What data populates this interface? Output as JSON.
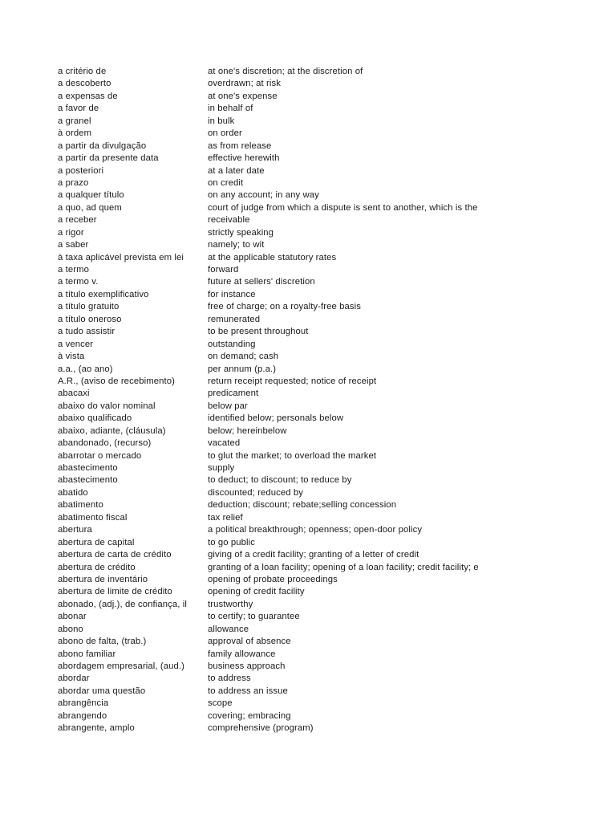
{
  "document": {
    "type": "glossary",
    "page_background": "#ffffff",
    "text_color": "#1a1a1a",
    "columns": {
      "term_header": "",
      "definition_header": ""
    }
  },
  "entries": [
    {
      "term": "a critério de",
      "definition": "at one's discretion; at the discretion of"
    },
    {
      "term": "a descoberto",
      "definition": "overdrawn; at risk"
    },
    {
      "term": "a expensas de",
      "definition": "at one's expense"
    },
    {
      "term": "a favor de",
      "definition": "in behalf of"
    },
    {
      "term": "a granel",
      "definition": "in bulk"
    },
    {
      "term": "à ordem",
      "definition": "on order"
    },
    {
      "term": "a partir da divulgação",
      "definition": "as from release"
    },
    {
      "term": "a partir da presente data",
      "definition": "effective herewith"
    },
    {
      "term": "a posteriori",
      "definition": "at a later date"
    },
    {
      "term": "a prazo",
      "definition": "on credit"
    },
    {
      "term": "a qualquer título",
      "definition": "on any account; in any way"
    },
    {
      "term": "a quo, ad quem",
      "definition": "court of judge from which a dispute is sent to another, which is the"
    },
    {
      "term": "a receber",
      "definition": "receivable"
    },
    {
      "term": "a rigor",
      "definition": "strictly speaking"
    },
    {
      "term": "a saber",
      "definition": "namely; to wit"
    },
    {
      "term": "à taxa aplicável prevista em lei",
      "definition": "at the applicable statutory rates"
    },
    {
      "term": "a termo",
      "definition": "forward"
    },
    {
      "term": "a termo v.",
      "definition": "future at sellers' discretion"
    },
    {
      "term": "a título exemplificativo",
      "definition": "for instance"
    },
    {
      "term": "a título gratuito",
      "definition": "free of charge; on a royalty-free basis"
    },
    {
      "term": "a título oneroso",
      "definition": "remunerated"
    },
    {
      "term": "a tudo assistir",
      "definition": "to be present throughout"
    },
    {
      "term": "a vencer",
      "definition": "outstanding"
    },
    {
      "term": "à vista",
      "definition": "on demand; cash"
    },
    {
      "term": "a.a., (ao ano)",
      "definition": "per annum (p.a.)"
    },
    {
      "term": "A.R., (aviso de recebimento)",
      "definition": "return receipt requested; notice of receipt"
    },
    {
      "term": "abacaxi",
      "definition": "predicament"
    },
    {
      "term": "abaixo do valor nominal",
      "definition": "below par"
    },
    {
      "term": "abaixo qualificado",
      "definition": "identified below; personals below"
    },
    {
      "term": "abaixo, adiante, (cláusula)",
      "definition": "below; hereinbelow"
    },
    {
      "term": "abandonado, (recurso)",
      "definition": "vacated"
    },
    {
      "term": "abarrotar o mercado",
      "definition": "to glut the market; to overload the market"
    },
    {
      "term": "abastecimento",
      "definition": "supply"
    },
    {
      "term": "abastecimento",
      "definition": "to deduct; to discount; to reduce by"
    },
    {
      "term": "abatido",
      "definition": "discounted; reduced by"
    },
    {
      "term": "abatimento",
      "definition": "deduction; discount; rebate;selling concession"
    },
    {
      "term": "abatimento fiscal",
      "definition": "tax relief"
    },
    {
      "term": "abertura",
      "definition": "a political breakthrough; openness; open-door policy"
    },
    {
      "term": "abertura de capital",
      "definition": "to go public"
    },
    {
      "term": "abertura de carta de crédito",
      "definition": "giving of a credit facility; granting of a letter of credit"
    },
    {
      "term": "abertura de crédito",
      "definition": "granting of a loan facility; opening of a loan facility; credit facility; e"
    },
    {
      "term": "abertura de inventário",
      "definition": "opening of probate proceedings"
    },
    {
      "term": "abertura de limite de crédito",
      "definition": "opening of credit facility"
    },
    {
      "term": "abonado, (adj.), de confiança, il",
      "definition": "trustworthy"
    },
    {
      "term": "abonar",
      "definition": "to certify; to guarantee"
    },
    {
      "term": "abono",
      "definition": "allowance"
    },
    {
      "term": "abono de falta, (trab.)",
      "definition": "approval of absence"
    },
    {
      "term": "abono familiar",
      "definition": "family allowance"
    },
    {
      "term": "abordagem empresarial, (aud.)",
      "definition": "business approach"
    },
    {
      "term": "abordar",
      "definition": "to address"
    },
    {
      "term": "abordar uma questão",
      "definition": "to address an issue"
    },
    {
      "term": "abrangência",
      "definition": "scope"
    },
    {
      "term": "abrangendo",
      "definition": "covering; embracing"
    },
    {
      "term": "abrangente, amplo",
      "definition": "comprehensive (program)"
    }
  ]
}
